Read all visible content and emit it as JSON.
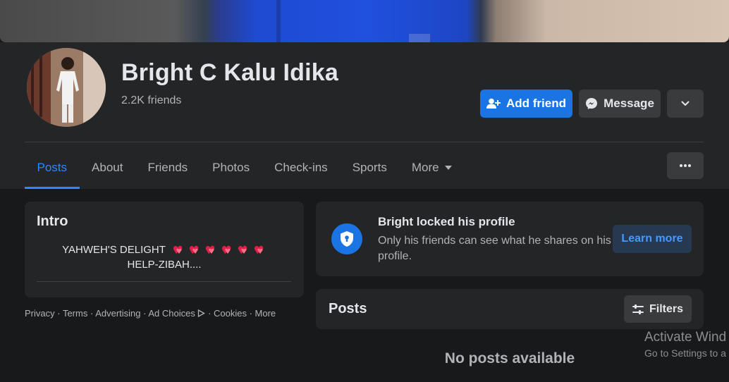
{
  "profile": {
    "name": "Bright C Kalu Idika",
    "friends_count": "2.2K friends"
  },
  "actions": {
    "add_friend": "Add friend",
    "message": "Message"
  },
  "tabs": [
    {
      "label": "Posts",
      "active": true
    },
    {
      "label": "About"
    },
    {
      "label": "Friends"
    },
    {
      "label": "Photos"
    },
    {
      "label": "Check-ins"
    },
    {
      "label": "Sports"
    },
    {
      "label": "More"
    }
  ],
  "intro": {
    "title": "Intro",
    "bio_line1": "YAHWEH'S DELIGHT",
    "bio_line2": "HELP-ZIBAH...."
  },
  "footer": {
    "links": [
      "Privacy",
      "Terms",
      "Advertising",
      "Ad Choices",
      "Cookies",
      "More"
    ]
  },
  "locked": {
    "title": "Bright locked his profile",
    "description": "Only his friends can see what he shares on his profile.",
    "learn_more": "Learn more"
  },
  "posts": {
    "title": "Posts",
    "filters": "Filters",
    "empty": "No posts available"
  },
  "watermark": {
    "line1": "Activate Wind",
    "line2": "Go to Settings to a"
  },
  "colors": {
    "background": "#18191a",
    "surface": "#242526",
    "accent": "#2d88ff",
    "primary_button": "#1b74e4",
    "secondary_button": "#3a3b3c",
    "heart": "#e0204a"
  }
}
